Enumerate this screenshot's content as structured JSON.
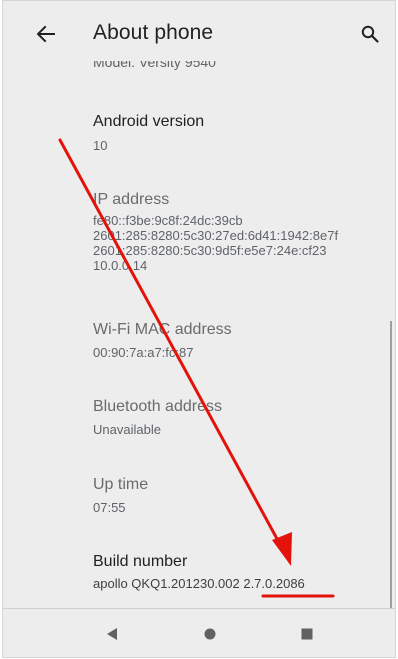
{
  "appbar": {
    "title": "About phone",
    "back_icon": "arrow-back-icon",
    "search_icon": "search-icon"
  },
  "clipped_row": {
    "text": "Model: Versity 9540"
  },
  "items": [
    {
      "title": "Android version",
      "summary": [
        "10"
      ]
    },
    {
      "title": "IP address",
      "summary": [
        "fe80::f3be:9c8f:24dc:39cb",
        "2601:285:8280:5c30:27ed:6d41:1942:8e7f",
        "2601:285:8280:5c30:9d5f:e5e7:24e:cf23",
        "10.0.0.14"
      ]
    },
    {
      "title": "Wi-Fi MAC address",
      "summary": [
        "00:90:7a:a7:fc:87"
      ]
    },
    {
      "title": "Bluetooth address",
      "summary": [
        "Unavailable"
      ]
    },
    {
      "title": "Up time",
      "summary": [
        "07:55"
      ]
    },
    {
      "title": "Build number",
      "summary": [
        "apollo QKQ1.201230.002 2.7.0.2086"
      ]
    }
  ],
  "navbar": {
    "back_icon": "triangle-back-icon",
    "home_icon": "circle-home-icon",
    "recents_icon": "square-recents-icon"
  },
  "annotation": {
    "color": "#e3120b",
    "arrow_icon": "red-arrow-annotation",
    "underline": "red-underline-annotation"
  },
  "colors": {
    "background": "#ededed",
    "title_text": "#202124",
    "summary_text": "#5f6368"
  }
}
